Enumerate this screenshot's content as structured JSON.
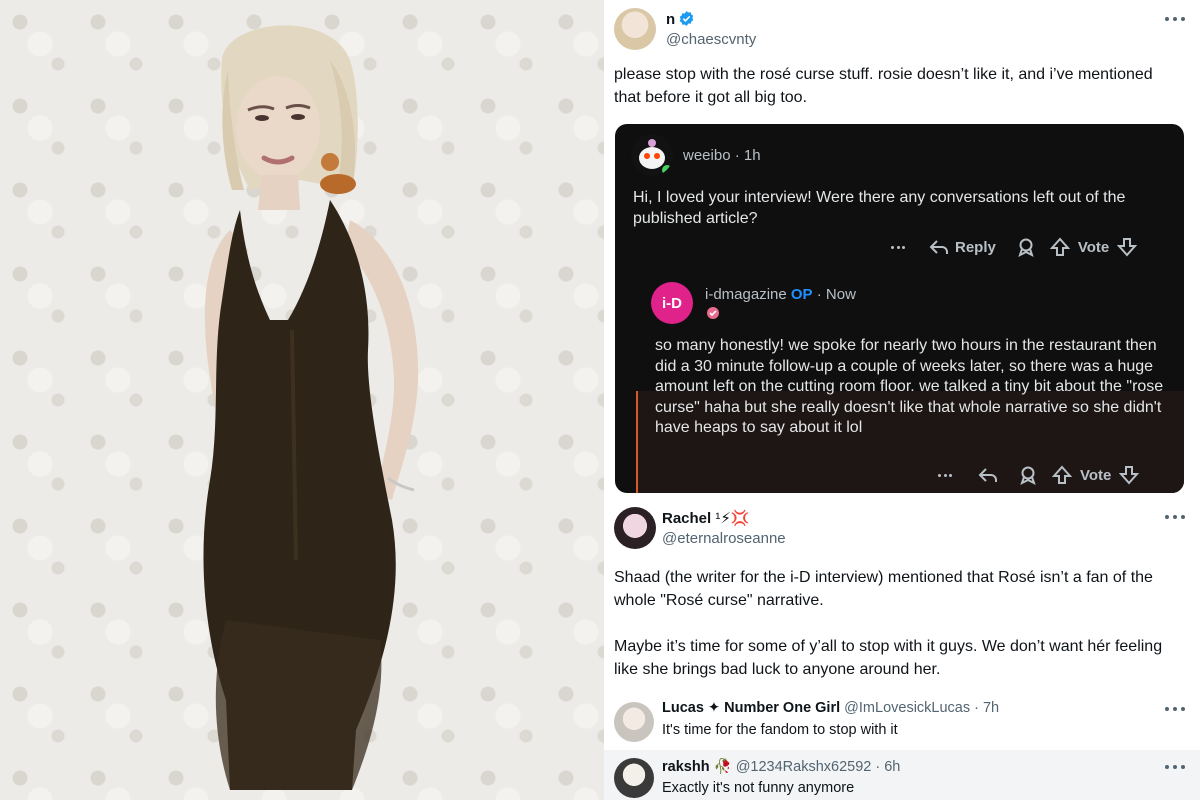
{
  "photo": {
    "subject": "woman in dark halter dress against patterned wallpaper"
  },
  "tweet": {
    "name": "n",
    "handle": "@chaescvnty",
    "text": "please stop with the rosé curse stuff. rosie doesn’t like it, and i’ve mentioned that before it got all big too."
  },
  "reddit": {
    "comment": {
      "user": "weeibo",
      "time": "· 1h",
      "text": "Hi, I loved your interview! Were there any conversations left out of the published article?",
      "reply_label": "Reply",
      "vote_label": "Vote"
    },
    "reply": {
      "user": "i-dmagazine",
      "op": "OP",
      "time": "· Now",
      "logo_text": "i-D",
      "text": "so many honestly! we spoke for nearly two hours in the restaurant then did a 30 minute follow-up a couple of weeks later, so there was a huge amount left on the cutting room floor. we talked a tiny bit about the \"rose curse\" haha but she really doesn't like that whole narrative so she didn't have heaps to say about it lol",
      "vote_label": "Vote"
    }
  },
  "tweet2": {
    "name": "Rachel",
    "name_suffix": "¹⚡💢",
    "handle": "@eternalroseanne",
    "text1": "Shaad (the writer for the i-D interview) mentioned that Rosé isn’t a fan of the whole \"Rosé curse\" narrative.",
    "text2": "Maybe it’s time for some of y’all to stop with it guys. We don’t want hér feeling like she brings bad luck to anyone around her."
  },
  "replies": [
    {
      "name": "Lucas ✦ Number One Girl",
      "handle": "@ImLovesickLucas · 7h",
      "text": "It's time for the fandom to stop with it"
    },
    {
      "name": "rakshh",
      "name_suffix": "🥀",
      "handle": "@1234Rakshx62592 · 6h",
      "text": "Exactly it's not funny anymore"
    }
  ],
  "colors": {
    "verified": "#1d9bf0",
    "reddit_bg": "#0f0f0f",
    "reply_bg": "#1d1615",
    "thread_line": "#d75b2a",
    "op": "#1e90ff"
  }
}
